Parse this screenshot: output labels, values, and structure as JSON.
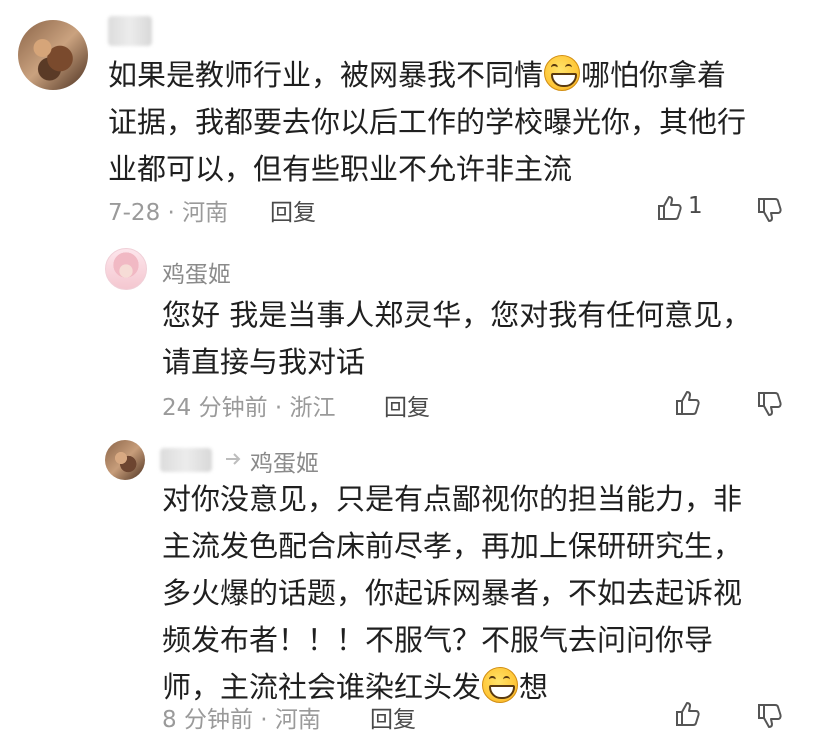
{
  "comments": [
    {
      "text_part1": "如果是教师行业，被网暴我不同情",
      "emoji_icon": "grin-emoji",
      "text_part2": "哪怕你拿着",
      "line2": "证据，我都要去你以后工作的学校曝光你，其他行",
      "line3": "业都可以，但有些职业不允许非主流",
      "meta": "7-28 · 河南",
      "reply_label": "回复",
      "like_count": "1"
    },
    {
      "username": "鸡蛋姬",
      "line1": "您好 我是当事人郑灵华，您对我有任何意见，",
      "line2": "请直接与我对话",
      "meta": "24 分钟前 · 浙江",
      "reply_label": "回复"
    },
    {
      "reply_to": "鸡蛋姬",
      "line1": "对你没意见，只是有点鄙视你的担当能力，非",
      "line2": "主流发色配合床前尽孝，再加上保研研究生，",
      "line3": "多火爆的话题，你起诉网暴者，不如去起诉视",
      "line4": "频发布者！！！不服气？不服气去问问你导",
      "line5_part1": "师，主流社会谁染红头发",
      "emoji_icon": "grin-emoji",
      "line5_part2": "想",
      "meta": "8 分钟前 · 河南",
      "reply_label": "回复"
    }
  ]
}
